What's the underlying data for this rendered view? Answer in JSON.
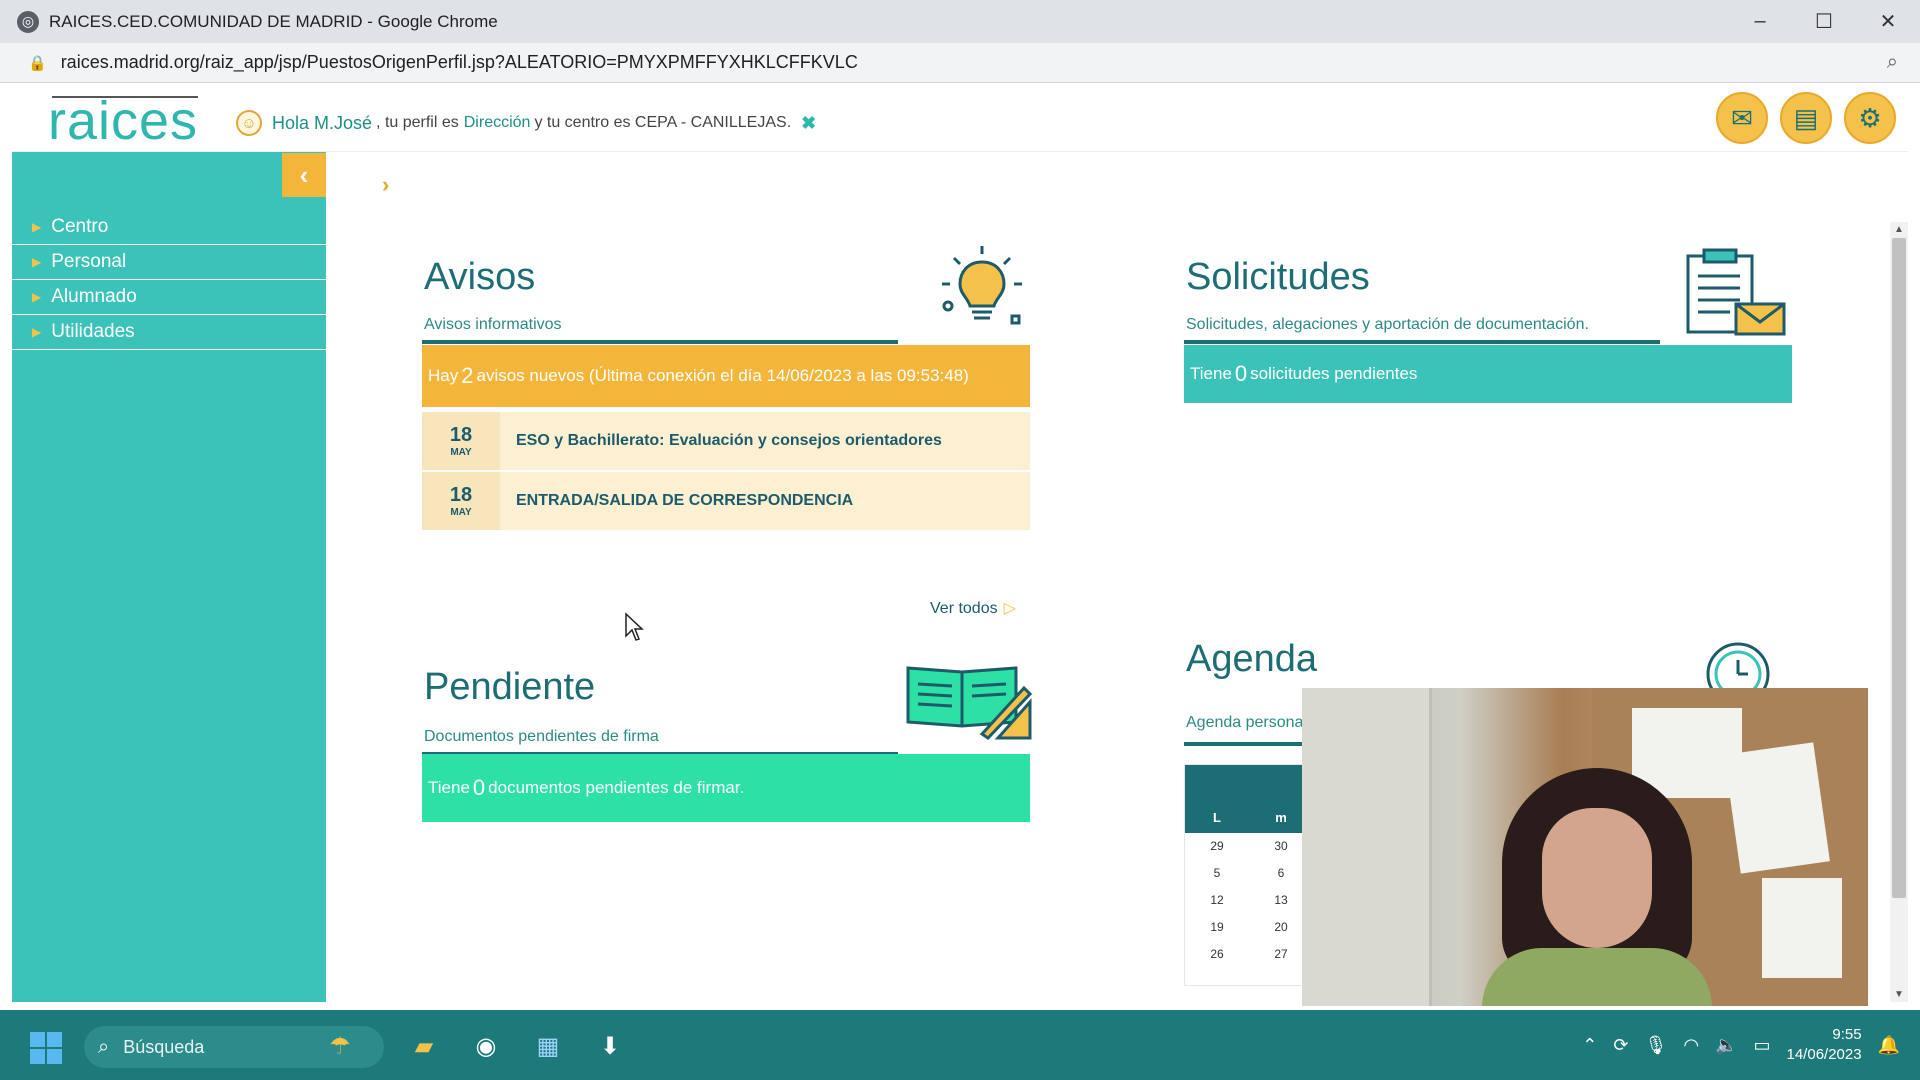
{
  "browser": {
    "window_title": "RAICES.CED.COMUNIDAD DE MADRID - Google Chrome",
    "url": "raices.madrid.org/raiz_app/jsp/PuestosOrigenPerfil.jsp?ALEATORIO=PMYXPMFFYXHKLCFFKVLC"
  },
  "header": {
    "logo": "raices",
    "greeting": "Hola M.José",
    "profile_prefix": ", tu perfil es",
    "profile": "Dirección",
    "center_text": "y tu centro es CEPA - CANILLEJAS."
  },
  "sidebar": {
    "items": [
      {
        "label": "Centro"
      },
      {
        "label": "Personal"
      },
      {
        "label": "Alumnado"
      },
      {
        "label": "Utilidades"
      }
    ]
  },
  "avisos": {
    "title": "Avisos",
    "subtitle": "Avisos informativos",
    "banner_prefix": "Hay",
    "banner_count": "2",
    "banner_suffix": "avisos nuevos (Última conexión el día 14/06/2023 a las 09:53:48)",
    "items": [
      {
        "day": "18",
        "month": "MAY",
        "text": "ESO y Bachillerato: Evaluación y consejos orientadores"
      },
      {
        "day": "18",
        "month": "MAY",
        "text": "ENTRADA/SALIDA DE CORRESPONDENCIA"
      }
    ],
    "see_all": "Ver todos"
  },
  "solicitudes": {
    "title": "Solicitudes",
    "subtitle": "Solicitudes, alegaciones y aportación de documentación.",
    "banner_prefix": "Tiene",
    "banner_count": "0",
    "banner_suffix": "solicitudes pendientes"
  },
  "pendiente": {
    "title": "Pendiente",
    "subtitle": "Documentos pendientes de firma",
    "banner_prefix": "Tiene",
    "banner_count": "0",
    "banner_suffix": "documentos pendientes de firmar."
  },
  "agenda": {
    "title": "Agenda",
    "subtitle": "Agenda persona",
    "weekdays": [
      "L",
      "m"
    ],
    "rows": [
      [
        "29",
        "30"
      ],
      [
        "5",
        "6"
      ],
      [
        "12",
        "13"
      ],
      [
        "19",
        "20"
      ],
      [
        "26",
        "27"
      ]
    ]
  },
  "taskbar": {
    "search_placeholder": "Búsqueda",
    "time": "9:55",
    "date": "14/06/2023"
  },
  "colors": {
    "teal": "#3cc3b9",
    "dark_teal": "#1d6e74",
    "amber": "#f4b63a",
    "green": "#2de0a5"
  }
}
